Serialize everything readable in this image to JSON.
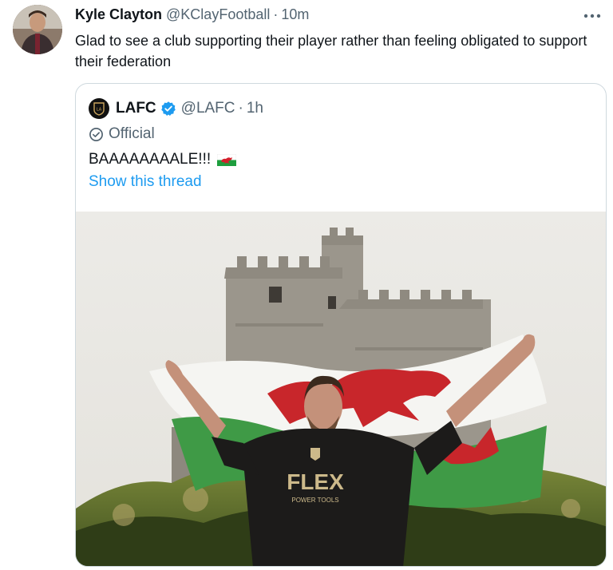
{
  "tweet": {
    "author_name": "Kyle Clayton",
    "author_handle": "@KClayFootball",
    "separator": "·",
    "time": "10m",
    "more_icon": "more-horizontal-icon",
    "text": "Glad to see a club supporting their player rather than feeling obligated to support their federation"
  },
  "quoted": {
    "author_name": "LAFC",
    "author_handle": "@LAFC",
    "separator": "·",
    "time": "1h",
    "verified_icon": "verified-badge-icon",
    "label_icon": "official-check-icon",
    "label": "Official",
    "text": "BAAAAAAAALE!!!",
    "emoji": "wales-flag-icon",
    "thread_link": "Show this thread",
    "photo": {
      "description_icon": "photo",
      "jersey_text": "FLEX",
      "jersey_subtext": "POWER TOOLS"
    }
  },
  "colors": {
    "text": "#0f1419",
    "secondary": "#536471",
    "link": "#1d9bf0",
    "border": "#cfd9de"
  }
}
